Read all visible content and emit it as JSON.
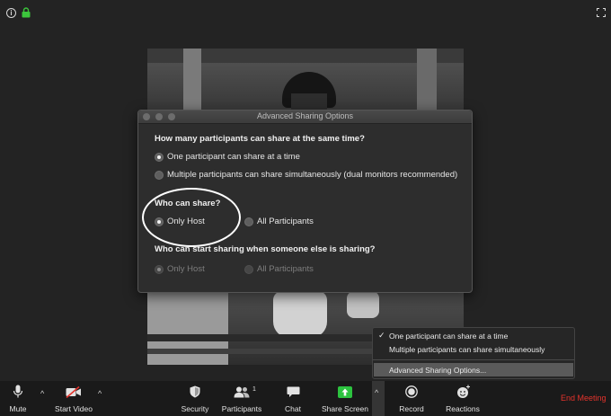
{
  "topbar": {
    "info_icon": "info-icon",
    "info_glyph": "i",
    "lock_icon": "lock-icon",
    "fullscreen_icon": "fullscreen-icon"
  },
  "dialog": {
    "title": "Advanced Sharing Options",
    "q1": "How many participants can share at the same time?",
    "q1_options": [
      {
        "label": "One participant can share at a time",
        "checked": true
      },
      {
        "label": "Multiple participants can share simultaneously (dual monitors recommended)",
        "checked": false
      }
    ],
    "q2": "Who can share?",
    "q2_options": [
      {
        "label": "Only Host",
        "checked": true
      },
      {
        "label": "All Participants",
        "checked": false
      }
    ],
    "q3": "Who can start sharing when someone else is sharing?",
    "q3_options": [
      {
        "label": "Only Host",
        "checked": true,
        "disabled": true
      },
      {
        "label": "All Participants",
        "checked": false,
        "disabled": true
      }
    ]
  },
  "share_menu": {
    "check": "✓",
    "items": [
      {
        "label": "One participant can share at a time",
        "checked": true
      },
      {
        "label": "Multiple participants can share simultaneously",
        "checked": false
      },
      {
        "label": "Advanced Sharing Options...",
        "highlighted": true
      }
    ]
  },
  "toolbar": {
    "mute": "Mute",
    "start_video": "Start Video",
    "security": "Security",
    "participants": "Participants",
    "participants_count": "1",
    "chat": "Chat",
    "share_screen": "Share Screen",
    "record": "Record",
    "reactions": "Reactions",
    "end_meeting": "End Meeting",
    "caret": "^",
    "colors": {
      "share_green": "#2cc33f",
      "end_red": "#e4332c",
      "lock_green": "#3cc63c"
    }
  }
}
